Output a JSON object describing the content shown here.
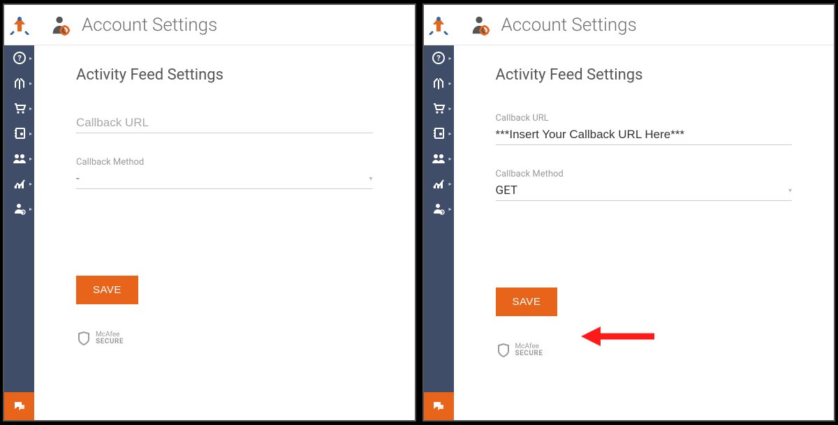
{
  "header": {
    "page_title": "Account Settings"
  },
  "section_heading": "Activity Feed Settings",
  "fields": {
    "callback_url_label": "Callback URL",
    "callback_method_label": "Callback Method"
  },
  "left": {
    "callback_url_value": "",
    "callback_url_placeholder": "Callback URL",
    "callback_method_value": "-"
  },
  "right": {
    "callback_url_value": "***Insert Your Callback URL Here***",
    "callback_method_value": "GET"
  },
  "buttons": {
    "save": "SAVE"
  },
  "footer": {
    "mcafee_top": "McAfee",
    "mcafee_bottom": "SECURE"
  },
  "sidebar": {
    "items": [
      "help",
      "routes",
      "orders",
      "address-book",
      "team",
      "analytics",
      "account"
    ]
  }
}
